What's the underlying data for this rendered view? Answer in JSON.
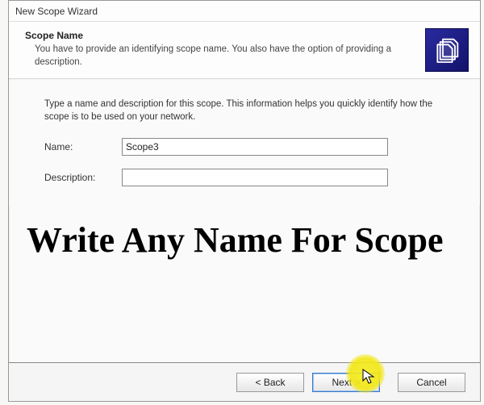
{
  "window": {
    "title": "New Scope Wizard"
  },
  "header": {
    "title": "Scope Name",
    "description": "You have to provide an identifying scope name. You also have the option of providing a description.",
    "icon_name": "scope-files-icon"
  },
  "body": {
    "instruction": "Type a name and description for this scope. This information helps you quickly identify how the scope is to be used on your network.",
    "name_label": "Name:",
    "name_value": "Scope3",
    "description_label": "Description:",
    "description_value": ""
  },
  "overlay": {
    "text": "Write Any Name For Scope"
  },
  "buttons": {
    "back": "< Back",
    "next": "Next >",
    "cancel": "Cancel"
  }
}
